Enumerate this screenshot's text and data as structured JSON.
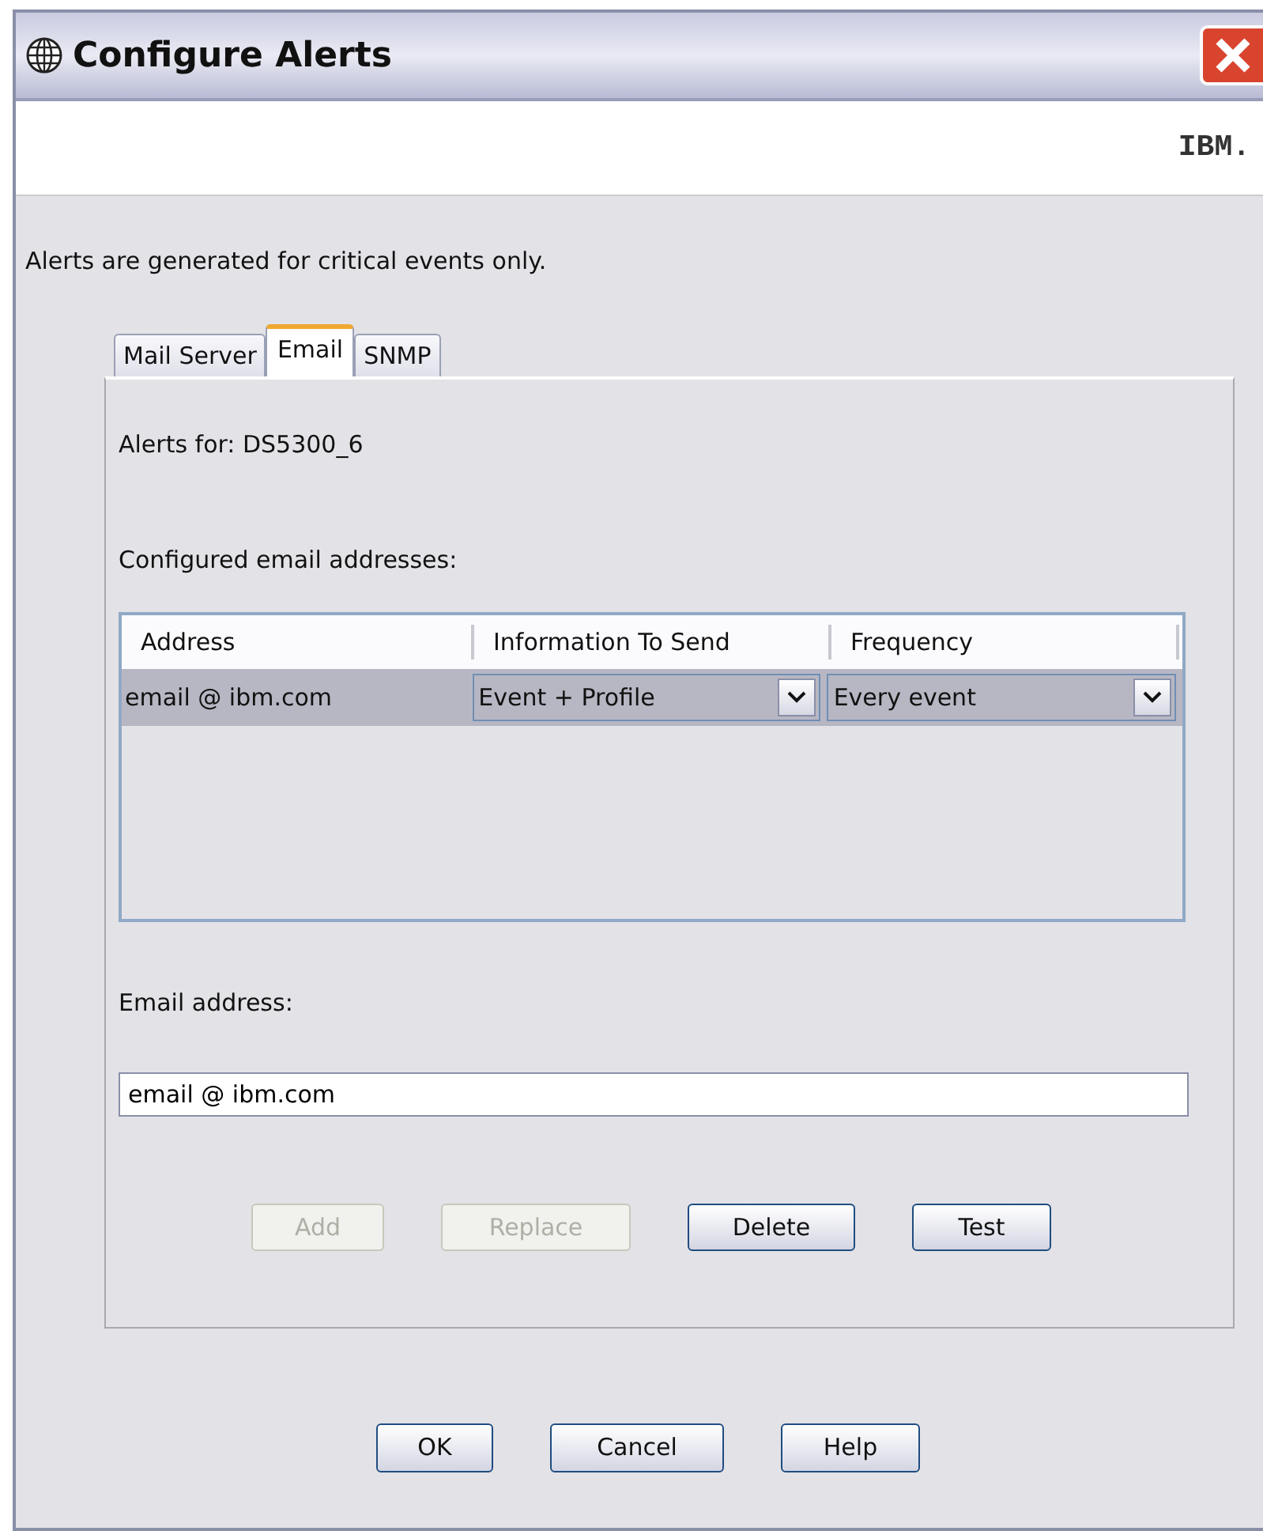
{
  "window": {
    "title": "Configure Alerts",
    "logo": "IBM."
  },
  "intro": "Alerts are generated for critical events only.",
  "tabs": [
    {
      "label": "Mail Server",
      "selected": false
    },
    {
      "label": "Email",
      "selected": true
    },
    {
      "label": "SNMP",
      "selected": false
    }
  ],
  "alerts_for": "Alerts for: DS5300_6",
  "table_label": "Configured email addresses:",
  "table": {
    "columns": [
      "Address",
      "Information To Send",
      "Frequency"
    ],
    "rows": [
      {
        "address": "email @ ibm.com",
        "information": "Event + Profile",
        "frequency": "Every event",
        "selected": true
      }
    ]
  },
  "email_label": "Email address:",
  "email_field": {
    "value": "email @ ibm.com"
  },
  "panel_buttons": [
    {
      "label": "Add",
      "disabled": true
    },
    {
      "label": "Replace",
      "disabled": true
    },
    {
      "label": "Delete",
      "disabled": false
    },
    {
      "label": "Test",
      "disabled": false
    }
  ],
  "dialog_buttons": [
    {
      "label": "OK",
      "disabled": false
    },
    {
      "label": "Cancel",
      "disabled": false
    },
    {
      "label": "Help",
      "disabled": false
    }
  ]
}
